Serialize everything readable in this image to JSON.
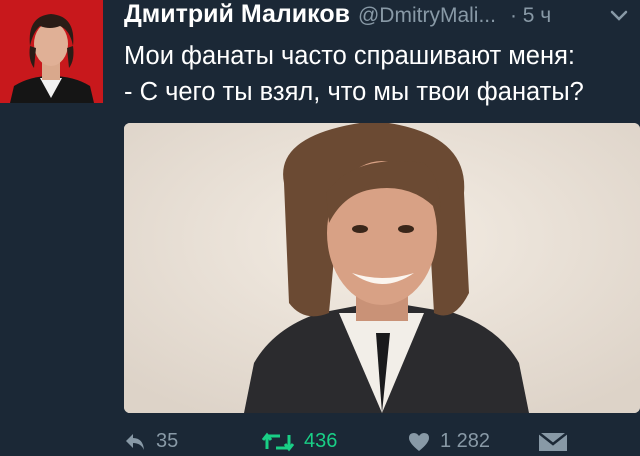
{
  "tweet": {
    "author_name": "Дмитрий Маликов",
    "author_handle": "@DmitryMali...",
    "time": "· 5 ч",
    "text_lines": [
      "Мои фанаты часто спрашивают меня:",
      "- С чего ты взял, что мы твои фанаты?"
    ]
  },
  "actions": {
    "reply_count": "35",
    "retweet_count": "436",
    "like_count": "1 282"
  },
  "colors": {
    "background": "#1b2836",
    "secondary_text": "#8899a6",
    "retweet_green": "#19cf86",
    "avatar_red": "#c8181c"
  },
  "icons": [
    "chevron-down-icon",
    "reply-icon",
    "retweet-icon",
    "heart-icon",
    "message-icon"
  ]
}
